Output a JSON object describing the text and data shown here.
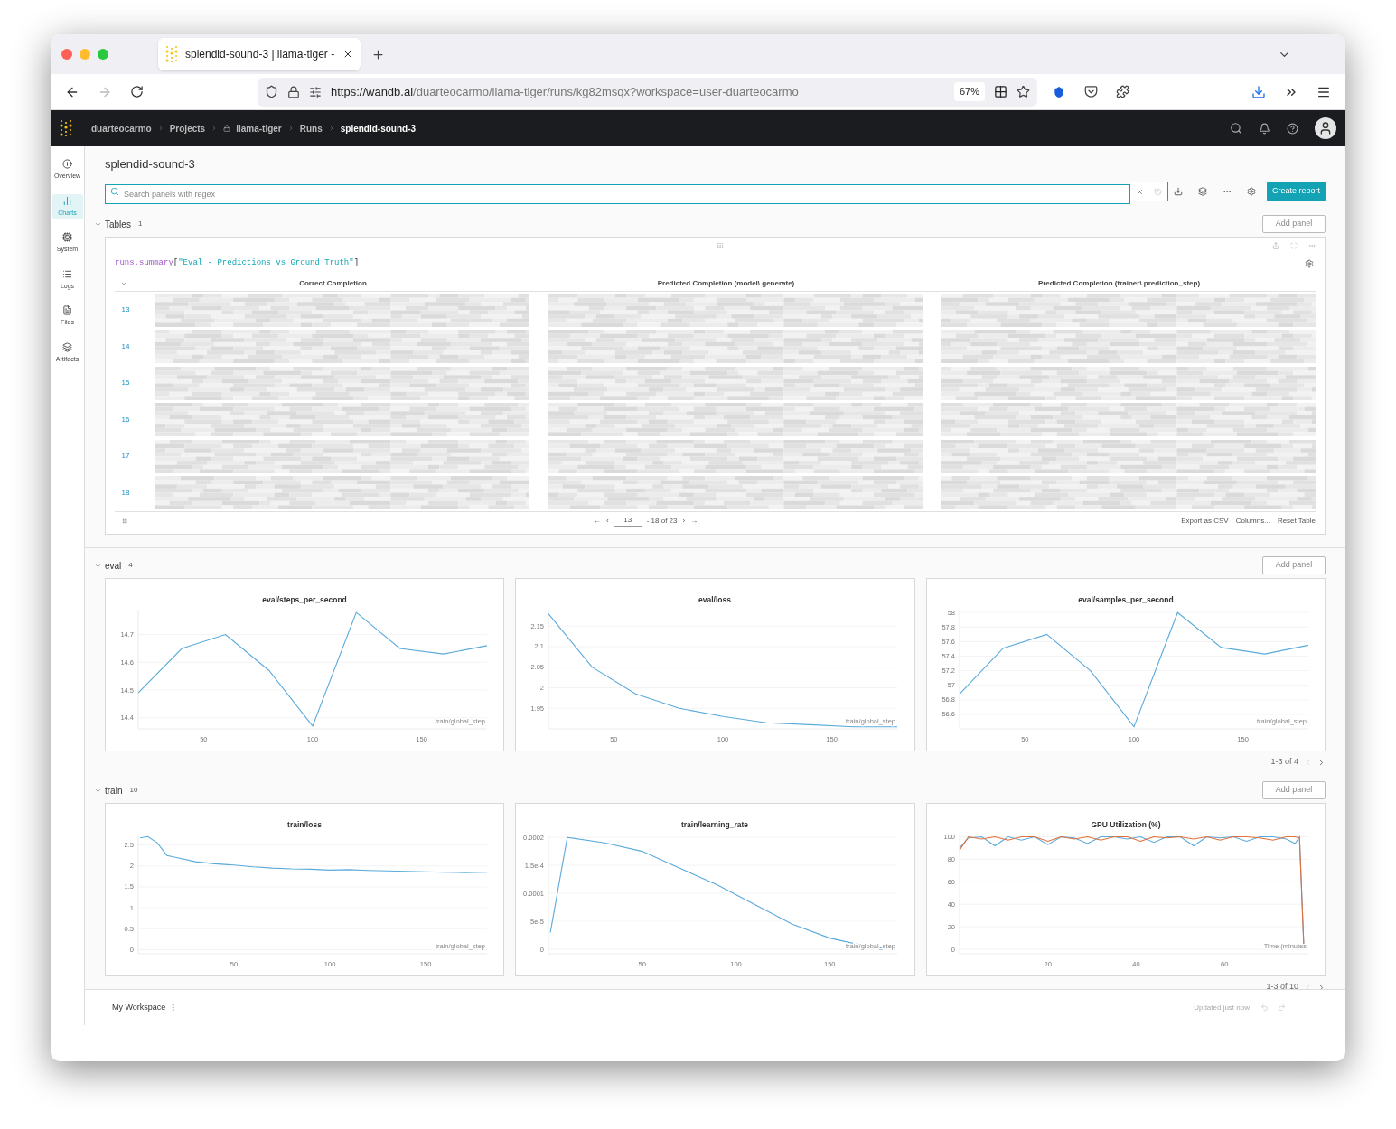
{
  "browser": {
    "tab_title": "splendid-sound-3 | llama-tiger -",
    "url_host": "https://wandb.ai",
    "url_path": "/duarteocarmo/llama-tiger/runs/kg82msqx?workspace=user-duarteocarmo",
    "zoom": "67%"
  },
  "breadcrumb": [
    {
      "label": "duarteocarmo",
      "kind": "link"
    },
    {
      "label": "Projects",
      "kind": "link"
    },
    {
      "label": "llama-tiger",
      "kind": "locked"
    },
    {
      "label": "Runs",
      "kind": "link"
    },
    {
      "label": "splendid-sound-3",
      "kind": "current"
    }
  ],
  "sidebar": [
    {
      "label": "Overview",
      "selected": false
    },
    {
      "label": "Charts",
      "selected": true
    },
    {
      "label": "System",
      "selected": false
    },
    {
      "label": "Logs",
      "selected": false
    },
    {
      "label": "Files",
      "selected": false
    },
    {
      "label": "Artifacts",
      "selected": false
    }
  ],
  "run_title": "splendid-sound-3",
  "search": {
    "placeholder": "Search panels with regex"
  },
  "create_report": "Create report",
  "sections": [
    {
      "kind": "table",
      "name": "Tables",
      "count": "1",
      "expanded": true,
      "add_panel": "Add panel",
      "table": {
        "query": [
          {
            "kind": "ident",
            "text": "runs.summary"
          },
          {
            "kind": "punct",
            "text": "["
          },
          {
            "kind": "string",
            "text": "\"Eval - Predictions vs Ground Truth\""
          },
          {
            "kind": "punct",
            "text": "]"
          }
        ],
        "columns": [
          "Correct Completion",
          "Predicted Completion (model\\.generate)",
          "Predicted Completion (trainer\\.prediction_step)"
        ],
        "rows": [
          "13",
          "14",
          "15",
          "16",
          "17",
          "18"
        ],
        "pagination": {
          "first": "←",
          "prev": "‹",
          "page": "13",
          "range": "- 18 of 23",
          "next": "›",
          "last": "→"
        },
        "actions": [
          "Export as CSV",
          "Columns...",
          "Reset Table"
        ]
      }
    },
    {
      "kind": "charts",
      "name": "eval",
      "count": "4",
      "expanded": true,
      "add_panel": "Add panel",
      "pager": "1-3 of 4",
      "charts": [
        {
          "chart_data": {
            "type": "line",
            "title": "eval/steps_per_second",
            "xlabel": "train/global_step",
            "grid": true,
            "x": [
              20,
              40,
              60,
              80,
              100,
              120,
              140,
              160,
              180
            ],
            "xlim": [
              20,
              180
            ],
            "ylim": [
              14.36,
              14.79
            ],
            "xticks": [
              50,
              100,
              150
            ],
            "yticks": [
              14.4,
              14.5,
              14.6,
              14.7
            ],
            "series": [
              {
                "color": "#5aaadb",
                "values": [
                  14.49,
                  14.65,
                  14.7,
                  14.57,
                  14.37,
                  14.78,
                  14.65,
                  14.63,
                  14.66
                ]
              }
            ]
          }
        },
        {
          "chart_data": {
            "type": "line",
            "title": "eval/loss",
            "xlabel": "train/global_step",
            "grid": true,
            "x": [
              20,
              40,
              60,
              80,
              100,
              120,
              140,
              160,
              180
            ],
            "xlim": [
              20,
              180
            ],
            "ylim": [
              1.9,
              2.19
            ],
            "xticks": [
              50,
              100,
              150
            ],
            "yticks": [
              1.95,
              2,
              2.05,
              2.1,
              2.15
            ],
            "series": [
              {
                "color": "#5aaadb",
                "values": [
                  2.18,
                  2.05,
                  1.985,
                  1.95,
                  1.93,
                  1.915,
                  1.91,
                  1.905,
                  1.905
                ]
              }
            ]
          }
        },
        {
          "chart_data": {
            "type": "line",
            "title": "eval/samples_per_second",
            "xlabel": "train/global_step",
            "grid": true,
            "x": [
              20,
              40,
              60,
              80,
              100,
              120,
              140,
              160,
              180
            ],
            "xlim": [
              20,
              180
            ],
            "ylim": [
              56.4,
              58.04
            ],
            "xticks": [
              50,
              100,
              150
            ],
            "yticks": [
              56.6,
              56.8,
              57,
              57.2,
              57.4,
              57.6,
              57.8,
              58
            ],
            "series": [
              {
                "color": "#5aaadb",
                "values": [
                  56.88,
                  57.51,
                  57.7,
                  57.2,
                  56.43,
                  58.0,
                  57.52,
                  57.43,
                  57.55
                ]
              }
            ]
          }
        }
      ]
    },
    {
      "kind": "charts",
      "name": "train",
      "count": "10",
      "expanded": true,
      "add_panel": "Add panel",
      "pager": "1-3 of 10",
      "charts": [
        {
          "chart_data": {
            "type": "line",
            "title": "train/loss",
            "xlabel": "train/global_step",
            "grid": true,
            "x": [
              1,
              5,
              10,
              15,
              20,
              30,
              40,
              50,
              60,
              70,
              80,
              90,
              100,
              110,
              120,
              130,
              140,
              150,
              160,
              170,
              180,
              182
            ],
            "xlim": [
              0,
              182
            ],
            "ylim": [
              -0.1,
              2.75
            ],
            "xticks": [
              50,
              100,
              150
            ],
            "yticks": [
              0,
              0.5,
              1,
              1.5,
              2,
              2.5
            ],
            "series": [
              {
                "color": "#5aaadb",
                "values": [
                  2.67,
                  2.7,
                  2.55,
                  2.25,
                  2.2,
                  2.1,
                  2.05,
                  2.02,
                  1.98,
                  1.95,
                  1.93,
                  1.92,
                  1.9,
                  1.91,
                  1.89,
                  1.88,
                  1.87,
                  1.86,
                  1.85,
                  1.84,
                  1.85,
                  1.85
                ]
              }
            ]
          }
        },
        {
          "chart_data": {
            "type": "line",
            "title": "train/learning_rate",
            "xlabel": "train/global_step",
            "grid": true,
            "x": [
              1,
              10,
              30,
              50,
              70,
              90,
              110,
              130,
              150,
              170,
              185
            ],
            "xlim": [
              0,
              186
            ],
            "ylim": [
              -8e-06,
              0.000205
            ],
            "xticks": [
              50,
              100,
              150
            ],
            "yticks": [
              0,
              {
                "value": 5e-05,
                "label": "5e-5"
              },
              0.0001,
              {
                "value": 0.00015,
                "label": "1.5e-4"
              },
              0.0002
            ],
            "series": [
              {
                "color": "#5aaadb",
                "values": [
                  3e-05,
                  0.0002,
                  0.00019,
                  0.000175,
                  0.000145,
                  0.000115,
                  8e-05,
                  4.5e-05,
                  2e-05,
                  5e-06,
                  0
                ]
              }
            ]
          }
        },
        {
          "chart_data": {
            "type": "line",
            "title": "GPU Utilization (%)",
            "xlabel": "Time (minutes",
            "grid": true,
            "x": [
              0,
              2,
              5,
              8,
              11,
              14,
              17,
              20,
              23,
              26,
              29,
              32,
              35,
              38,
              41,
              44,
              47,
              50,
              53,
              56,
              59,
              62,
              65,
              68,
              71,
              74,
              76,
              77,
              78
            ],
            "xlim": [
              0,
              79
            ],
            "ylim": [
              -4,
              102
            ],
            "xticks": [
              20,
              40,
              60
            ],
            "yticks": [
              0,
              20,
              40,
              60,
              80,
              100
            ],
            "series": [
              {
                "color": "#5aaadb",
                "values": [
                  90,
                  99,
                  100,
                  92,
                  100,
                  97,
                  100,
                  93,
                  100,
                  99,
                  94,
                  100,
                  100,
                  98,
                  100,
                  95,
                  100,
                  100,
                  92,
                  100,
                  99,
                  100,
                  96,
                  100,
                  100,
                  98,
                  94,
                  100,
                  0
                ]
              },
              {
                "color": "#e0703c",
                "values": [
                  88,
                  100,
                  98,
                  100,
                  97,
                  100,
                  100,
                  96,
                  100,
                  98,
                  100,
                  97,
                  100,
                  100,
                  96,
                  100,
                  99,
                  100,
                  98,
                  100,
                  97,
                  100,
                  100,
                  99,
                  97,
                  100,
                  100,
                  99,
                  0
                ]
              }
            ]
          }
        }
      ]
    }
  ],
  "workspace": "My Workspace",
  "status": "Updated just now"
}
